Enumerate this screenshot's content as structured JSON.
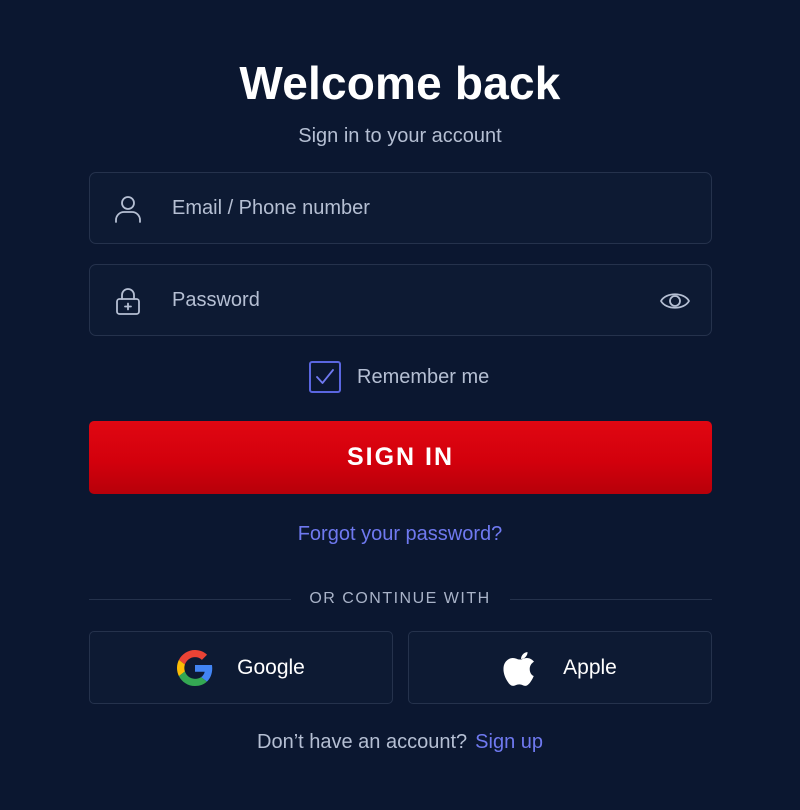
{
  "header": {
    "title": "Welcome back",
    "subtitle": "Sign in to your account"
  },
  "form": {
    "email": {
      "value": "",
      "placeholder": "Email / Phone number",
      "icon": "user-icon"
    },
    "password": {
      "value": "",
      "placeholder": "Password",
      "icon": "lock-icon",
      "toggle_icon": "eye-icon"
    },
    "remember": {
      "label": "Remember me",
      "checked": true
    },
    "submit_label": "SIGN IN",
    "forgot_label": "Forgot your password?"
  },
  "social": {
    "divider_label": "OR CONTINUE WITH",
    "google_label": "Google",
    "apple_label": "Apple"
  },
  "footer": {
    "question": "Don’t have an account?",
    "signup_label": "Sign up"
  },
  "colors": {
    "background": "#0b1730",
    "primary_button": "#d3000c",
    "link": "#6f79f0",
    "checkbox_border": "#5a66e0",
    "field_border": "#25324c"
  }
}
